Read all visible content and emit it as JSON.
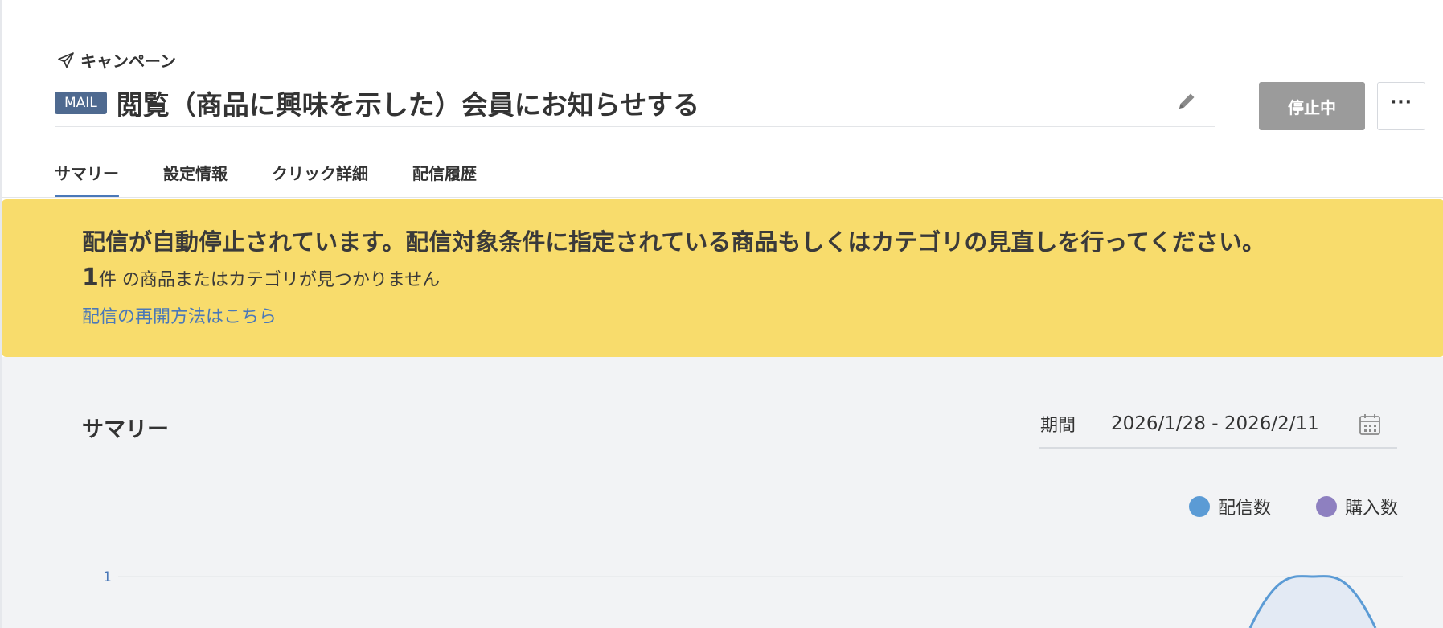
{
  "breadcrumb": {
    "label": "キャンペーン",
    "icon": "paper-plane-icon"
  },
  "campaign": {
    "type_badge": "MAIL",
    "title": "閲覧（商品に興味を示した）会員にお知らせする",
    "status_label": "停止中",
    "more_label": "···"
  },
  "tabs": [
    {
      "label": "サマリー",
      "active": true
    },
    {
      "label": "設定情報",
      "active": false
    },
    {
      "label": "クリック詳細",
      "active": false
    },
    {
      "label": "配信履歴",
      "active": false
    }
  ],
  "alert": {
    "heading": "配信が自動停止されています。配信対象条件に指定されている商品もしくはカテゴリの見直しを行ってください。",
    "count": "1",
    "count_unit": "件",
    "count_text": " の商品またはカテゴリが見つかりません",
    "link": "配信の再開方法はこちら"
  },
  "summary": {
    "title": "サマリー",
    "period_label": "期間",
    "period_value": "2026/1/28 - 2026/2/11"
  },
  "colors": {
    "accent": "#4a78b8",
    "alert_bg": "#f8dc6c",
    "badge": "#4f6a90",
    "status_button": "#9b9b9b",
    "series_deliveries": "#5b9bd5",
    "series_purchases": "#8e80c0"
  },
  "chart_data": {
    "type": "area",
    "series": [
      {
        "name": "配信数",
        "color": "#5b9bd5",
        "peak_value": 1
      },
      {
        "name": "購入数",
        "color": "#8e80c0"
      }
    ],
    "y_ticks": [
      "1"
    ],
    "ylim": [
      0,
      1
    ],
    "legend": "top-right",
    "grid": true
  }
}
